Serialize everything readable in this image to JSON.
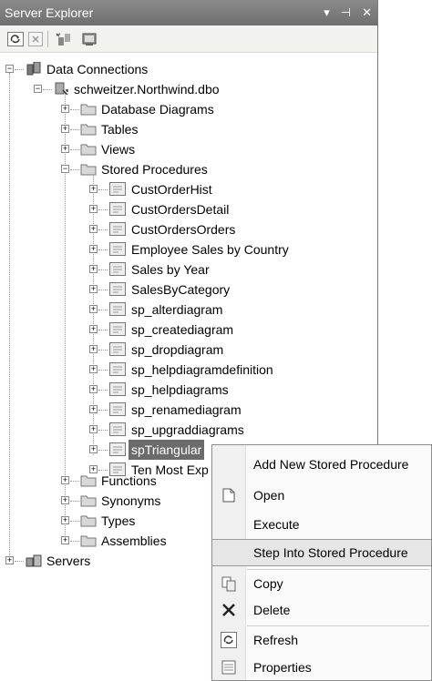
{
  "panel": {
    "title": "Server Explorer",
    "controls": [
      "▾",
      "⊣",
      "✕"
    ]
  },
  "tree": {
    "data_connections": "Data Connections",
    "connection": "schweitzer.Northwind.dbo",
    "folders_top": [
      "Database Diagrams",
      "Tables",
      "Views",
      "Stored Procedures"
    ],
    "stored_procedures": [
      "CustOrderHist",
      "CustOrdersDetail",
      "CustOrdersOrders",
      "Employee Sales by Country",
      "Sales by Year",
      "SalesByCategory",
      "sp_alterdiagram",
      "sp_creatediagram",
      "sp_dropdiagram",
      "sp_helpdiagramdefinition",
      "sp_helpdiagrams",
      "sp_renamediagram",
      "sp_upgraddiagrams",
      "spTriangular",
      "Ten Most Exp"
    ],
    "selected": "spTriangular",
    "folders_bottom": [
      "Functions",
      "Synonyms",
      "Types",
      "Assemblies"
    ],
    "servers": "Servers"
  },
  "context_menu": {
    "add_new": "Add New Stored Procedure",
    "open": "Open",
    "execute": "Execute",
    "step_into": "Step Into Stored Procedure",
    "copy": "Copy",
    "delete": "Delete",
    "refresh": "Refresh",
    "properties": "Properties"
  }
}
